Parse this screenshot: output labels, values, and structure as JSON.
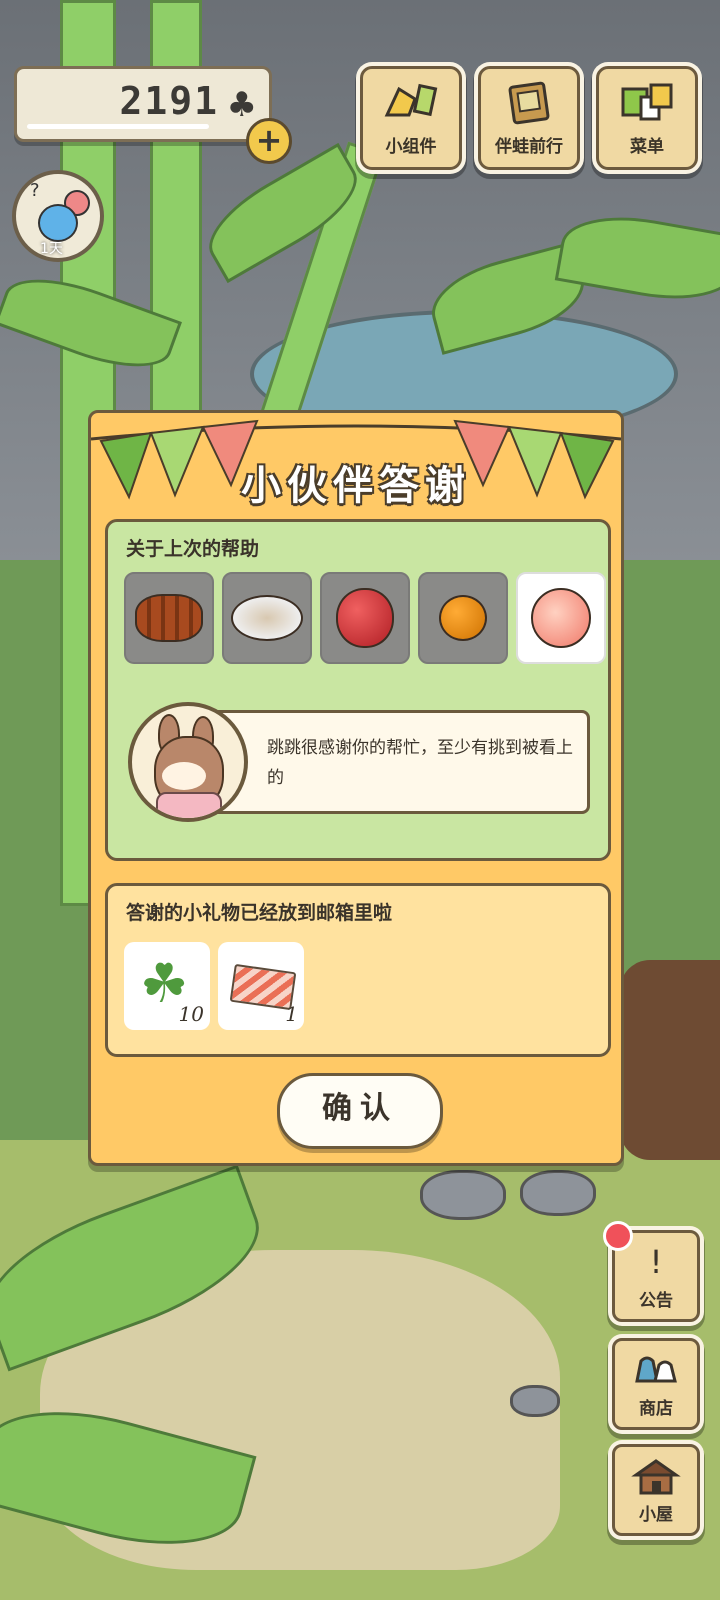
{
  "hud": {
    "clover_count": "2191",
    "clover_symbol": "♣",
    "plus_label": "+",
    "avatar_question": "?",
    "avatar_days": "1天"
  },
  "top_buttons": [
    {
      "label": "小组件",
      "icon": "widget-icon"
    },
    {
      "label": "伴蛙前行",
      "icon": "frog-journey-icon"
    },
    {
      "label": "菜单",
      "icon": "menu-icon"
    }
  ],
  "dialog": {
    "title": "小伙伴答谢",
    "help_heading": "关于上次的帮助",
    "items": [
      {
        "name": "skewers",
        "selected": false
      },
      {
        "name": "salad",
        "selected": false
      },
      {
        "name": "apple",
        "selected": false
      },
      {
        "name": "orange",
        "selected": false
      },
      {
        "name": "peach",
        "selected": true
      }
    ],
    "message": "跳跳很感谢你的帮忙，至少有挑到被看上的",
    "gift_heading": "答谢的小礼物已经放到邮箱里啦",
    "gifts": [
      {
        "name": "clover",
        "count": "10"
      },
      {
        "name": "ticket",
        "count": "1"
      }
    ],
    "confirm_label": "确认"
  },
  "side_buttons": [
    {
      "label": "公告",
      "icon": "notice-icon",
      "glyph": "!",
      "has_notification": true
    },
    {
      "label": "商店",
      "icon": "shop-icon",
      "glyph": "⛉"
    },
    {
      "label": "小屋",
      "icon": "house-icon",
      "glyph": "⌂"
    }
  ],
  "colors": {
    "dialog_bg": "#ffc966",
    "help_panel_bg": "#c9e6a2",
    "gift_panel_bg": "#ffe29f",
    "notification": "#f0515a"
  }
}
